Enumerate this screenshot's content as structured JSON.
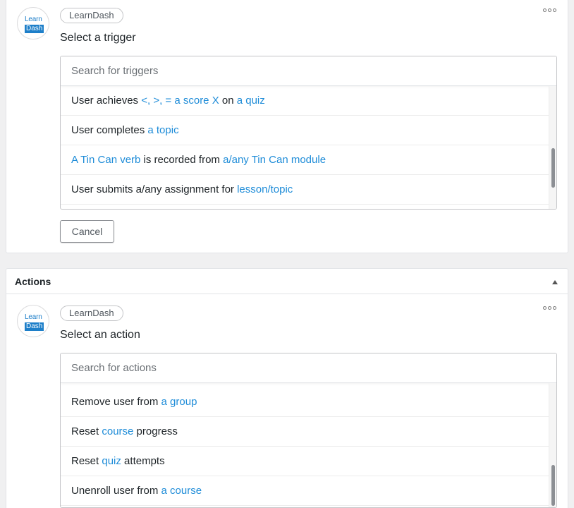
{
  "trigger": {
    "logo": {
      "line1": "Learn",
      "line2": "Dash"
    },
    "integration_badge": "LearnDash",
    "prompt": "Select a trigger",
    "search": {
      "placeholder": "Search for triggers",
      "value": ""
    },
    "options": [
      [
        {
          "t": "User achieves "
        },
        {
          "t": "<, >, = a score X",
          "hl": true
        },
        {
          "t": " on "
        },
        {
          "t": "a quiz",
          "hl": true
        }
      ],
      [
        {
          "t": "User completes "
        },
        {
          "t": "a topic",
          "hl": true
        }
      ],
      [
        {
          "t": "A Tin Can verb",
          "hl": true
        },
        {
          "t": " is recorded from "
        },
        {
          "t": "a/any Tin Can module",
          "hl": true
        }
      ],
      [
        {
          "t": "User submits a/any assignment for "
        },
        {
          "t": "lesson/topic",
          "hl": true
        }
      ]
    ],
    "cancel_label": "Cancel"
  },
  "actions": {
    "section_title": "Actions",
    "logo": {
      "line1": "Learn",
      "line2": "Dash"
    },
    "integration_badge": "LearnDash",
    "prompt": "Select an action",
    "search": {
      "placeholder": "Search for actions",
      "value": ""
    },
    "options": [
      [
        {
          "t": "Remove user from "
        },
        {
          "t": "a group",
          "hl": true
        }
      ],
      [
        {
          "t": "Reset "
        },
        {
          "t": "course",
          "hl": true
        },
        {
          "t": " progress"
        }
      ],
      [
        {
          "t": "Reset "
        },
        {
          "t": "quiz",
          "hl": true
        },
        {
          "t": " attempts"
        }
      ],
      [
        {
          "t": "Unenroll user from "
        },
        {
          "t": "a course",
          "hl": true
        }
      ]
    ]
  },
  "icons": {
    "more": "more-options-icon",
    "collapse": "chevron-up-icon"
  },
  "colors": {
    "accent": "#1e8cd8",
    "logo_blue": "#1e7fc9",
    "page_bg": "#f0f0f1"
  }
}
